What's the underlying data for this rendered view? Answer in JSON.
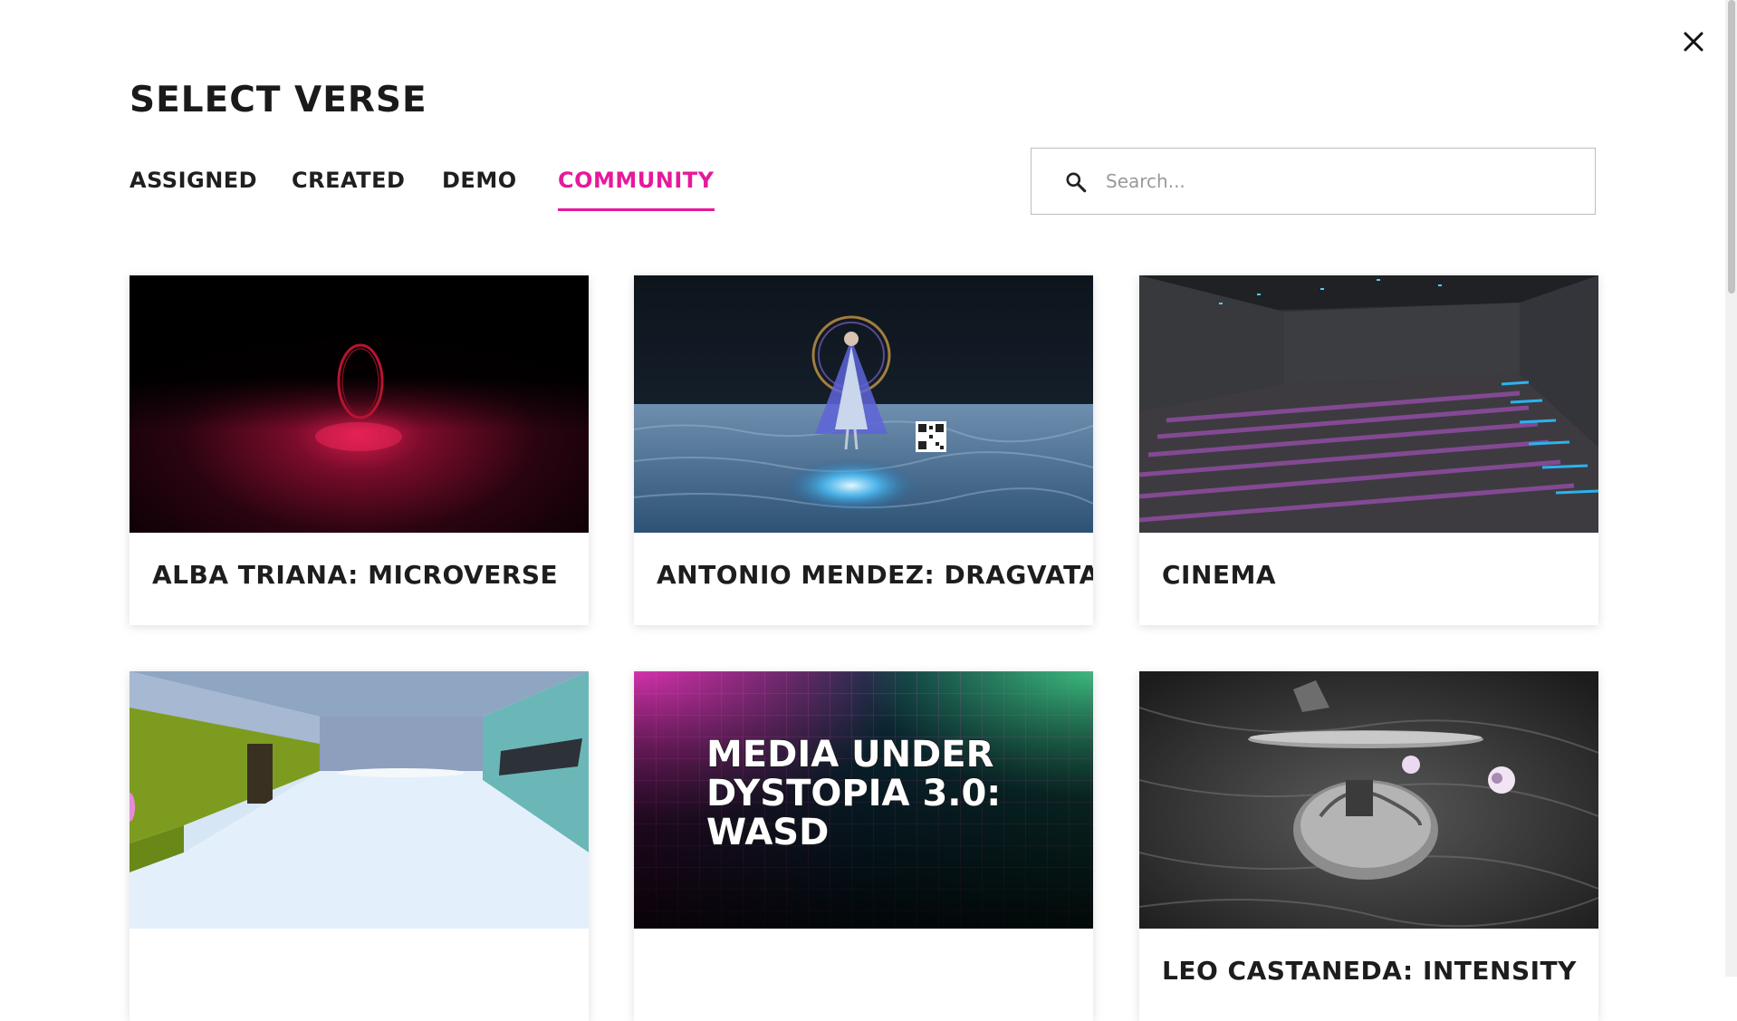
{
  "page": {
    "title": "SELECT VERSE"
  },
  "tabs": [
    {
      "label": "ASSIGNED",
      "active": false
    },
    {
      "label": "CREATED",
      "active": false
    },
    {
      "label": "DEMO",
      "active": false
    },
    {
      "label": "COMMUNITY",
      "active": true
    }
  ],
  "search": {
    "placeholder": "Search...",
    "value": ""
  },
  "verses": [
    {
      "title": "ALBA TRIANA: MICROVERSE"
    },
    {
      "title": "ANTONIO MENDEZ: DRAGVATAR"
    },
    {
      "title": "CINEMA"
    },
    {
      "title": ""
    },
    {
      "title": "",
      "thumbnail_text": [
        "MEDIA UNDER",
        "DYSTOPIA 3.0:",
        "WASD"
      ]
    },
    {
      "title": "LEO CASTANEDA: INTENSITY"
    }
  ],
  "colors": {
    "accent": "#e6199b",
    "text": "#1a1a1a"
  },
  "icons": {
    "close": "close-icon",
    "search": "search-icon"
  }
}
